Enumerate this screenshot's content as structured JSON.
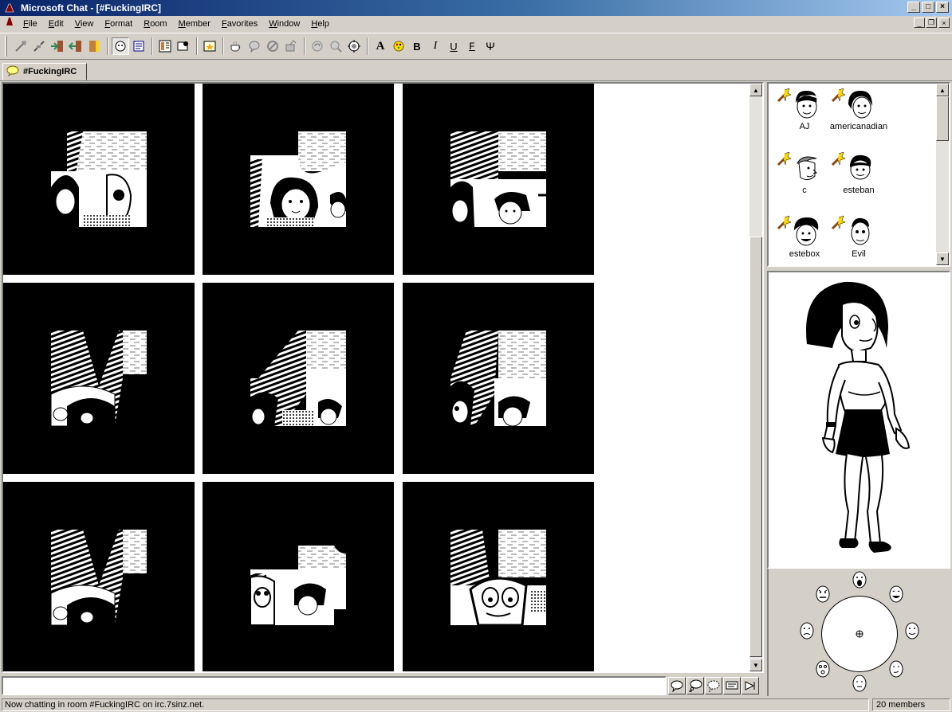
{
  "window": {
    "title": "Microsoft Chat - [#FuckingIRC]"
  },
  "menu": [
    {
      "label": "File",
      "key": "F",
      "rest": "ile"
    },
    {
      "label": "Edit",
      "key": "E",
      "rest": "dit"
    },
    {
      "label": "View",
      "key": "V",
      "rest": "iew"
    },
    {
      "label": "Format",
      "key": "F",
      "rest": "ormat"
    },
    {
      "label": "Room",
      "key": "R",
      "rest": "oom"
    },
    {
      "label": "Member",
      "key": "M",
      "rest": "ember"
    },
    {
      "label": "Favorites",
      "key": "F",
      "rest": "avorites"
    },
    {
      "label": "Window",
      "key": "W",
      "rest": "indow"
    },
    {
      "label": "Help",
      "key": "H",
      "rest": "elp"
    }
  ],
  "toolbar": {
    "format_bold": "B",
    "format_italic": "I",
    "format_underline": "U",
    "format_fixed": "F",
    "format_symbol": "Ψ",
    "format_font": "A"
  },
  "tab": {
    "label": "#FuckingIRC"
  },
  "members": [
    {
      "name": "AJ"
    },
    {
      "name": "americanadian"
    },
    {
      "name": "c"
    },
    {
      "name": "esteban"
    },
    {
      "name": "estebox"
    },
    {
      "name": "Evil"
    }
  ],
  "colors": {
    "titlebar_start": "#0a246a",
    "titlebar_end": "#a6caf0",
    "chrome": "#d4d0c8"
  },
  "input": {
    "value": "",
    "placeholder": ""
  },
  "status": {
    "message": "Now chatting in room #FuckingIRC on irc.7sinz.net.",
    "member_count": "20 members"
  }
}
